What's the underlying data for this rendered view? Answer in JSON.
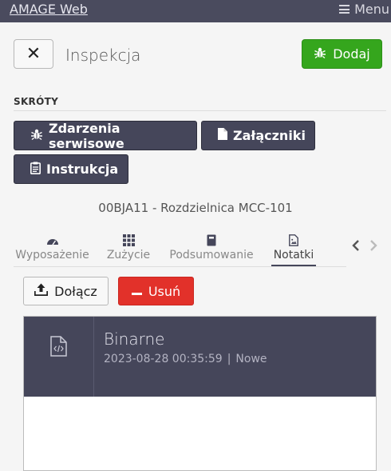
{
  "topbar": {
    "brand": "AMAGE Web",
    "menu_label": "Menu"
  },
  "header": {
    "close_glyph": "✕",
    "title": "Inspekcja",
    "add_label": "Dodaj",
    "add_icon": "bug-icon"
  },
  "shortcuts": {
    "label": "SKRÓTY",
    "buttons": [
      {
        "label": "Zdarzenia serwisowe",
        "icon": "bug-icon"
      },
      {
        "label": "Załączniki",
        "icon": "file-icon"
      },
      {
        "label": "Instrukcja",
        "icon": "clipboard-icon"
      }
    ]
  },
  "device": {
    "title": "00BJA11 - Rozdzielnica MCC-101"
  },
  "tabs": [
    {
      "label": "Wyposażenie",
      "icon": "gauge-icon",
      "active": false
    },
    {
      "label": "Zużycie",
      "icon": "grid-icon",
      "active": false
    },
    {
      "label": "Podsumowanie",
      "icon": "book-icon",
      "active": false
    },
    {
      "label": "Notatki",
      "icon": "file-image-icon",
      "active": true
    }
  ],
  "actions": {
    "attach_label": "Dołącz",
    "remove_label": "Usuń"
  },
  "attachment": {
    "name": "Binarne",
    "date": "2023-08-28 00:35:59",
    "separator": "|",
    "status": "Nowe",
    "icon": "file-code-icon"
  },
  "colors": {
    "dark": "#45465a",
    "success": "#35a61d",
    "danger": "#e2312a"
  }
}
